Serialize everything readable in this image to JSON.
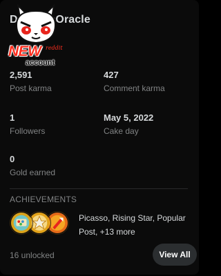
{
  "profile": {
    "username": "DmMessOracle",
    "badge_main": "NEW",
    "badge_small": "reddit",
    "badge_sub": "account"
  },
  "stats": {
    "post_karma": {
      "value": "2,591",
      "label": "Post karma"
    },
    "comment_karma": {
      "value": "427",
      "label": "Comment karma"
    },
    "followers": {
      "value": "1",
      "label": "Followers"
    },
    "cake_day": {
      "value": "May 5, 2022",
      "label": "Cake day"
    },
    "gold": {
      "value": "0",
      "label": "Gold earned"
    }
  },
  "achievements": {
    "title": "ACHIEVEMENTS",
    "summary": "Picasso, Rising Star, Popular Post, +13 more",
    "unlocked": "16 unlocked",
    "view_all": "View All",
    "icons": [
      "picasso-trophy-icon",
      "rising-star-trophy-icon",
      "popular-post-trophy-icon"
    ]
  },
  "colors": {
    "background": "#0b0b0b",
    "text": "#d7dadc",
    "muted": "#818384",
    "button": "#2b2e30",
    "badge_red": "#ff2f1f"
  }
}
